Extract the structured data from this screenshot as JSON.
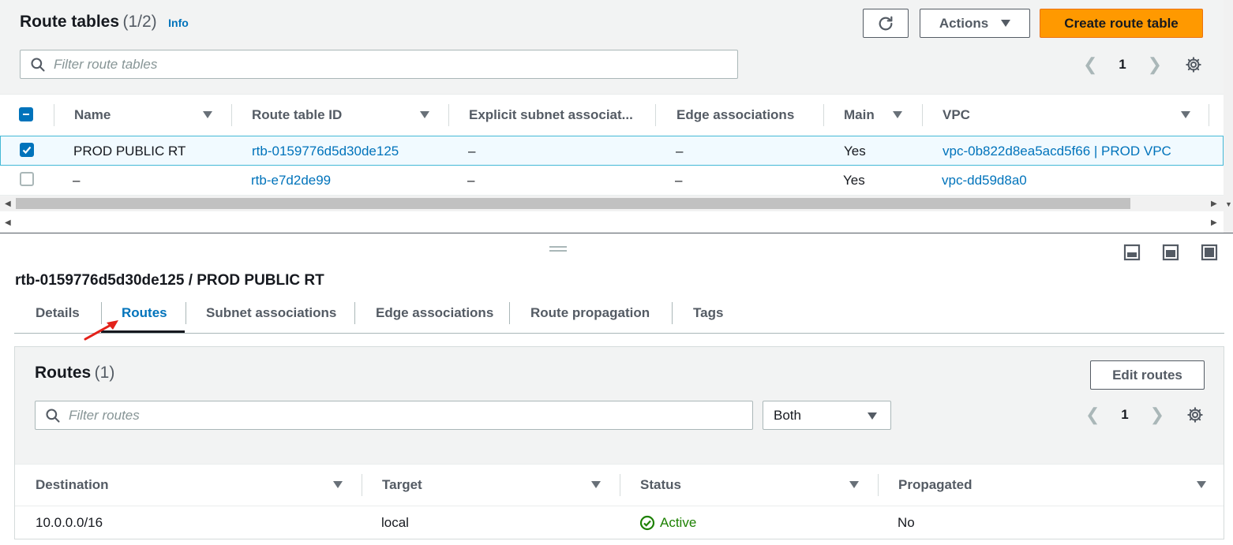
{
  "top": {
    "title": "Route tables",
    "count": "(1/2)",
    "info": "Info",
    "actions_label": "Actions",
    "create_label": "Create route table",
    "search_placeholder": "Filter route tables",
    "page": "1",
    "columns": [
      "Name",
      "Route table ID",
      "Explicit subnet associat...",
      "Edge associations",
      "Main",
      "VPC"
    ],
    "rows": [
      {
        "selected": true,
        "name": "PROD PUBLIC RT",
        "id": "rtb-0159776d5d30de125",
        "explicit": "–",
        "edge": "–",
        "main": "Yes",
        "vpc": "vpc-0b822d8ea5acd5f66 | PROD VPC"
      },
      {
        "selected": false,
        "name": "–",
        "id": "rtb-e7d2de99",
        "explicit": "–",
        "edge": "–",
        "main": "Yes",
        "vpc": "vpc-dd59d8a0"
      }
    ]
  },
  "detail": {
    "title": "rtb-0159776d5d30de125 / PROD PUBLIC RT",
    "tabs": [
      "Details",
      "Routes",
      "Subnet associations",
      "Edge associations",
      "Route propagation",
      "Tags"
    ],
    "active_tab": "Routes"
  },
  "routes": {
    "title": "Routes",
    "count": "(1)",
    "edit_label": "Edit routes",
    "search_placeholder": "Filter routes",
    "filter_value": "Both",
    "page": "1",
    "columns": [
      "Destination",
      "Target",
      "Status",
      "Propagated"
    ],
    "rows": [
      {
        "destination": "10.0.0.0/16",
        "target": "local",
        "status": "Active",
        "propagated": "No"
      }
    ]
  },
  "colors": {
    "primary": "#ff9900",
    "link": "#0073bb",
    "success": "#1d8102",
    "annotation": "#e3211a"
  },
  "icons": [
    "refresh-icon",
    "caret-down-icon",
    "search-icon",
    "chevron-left-icon",
    "chevron-right-icon",
    "settings-icon",
    "checkbox-icon",
    "success-icon",
    "drag-handle-icon",
    "panel-bottom-icon",
    "panel-side-icon",
    "panel-full-icon",
    "annotation-arrow-icon"
  ]
}
